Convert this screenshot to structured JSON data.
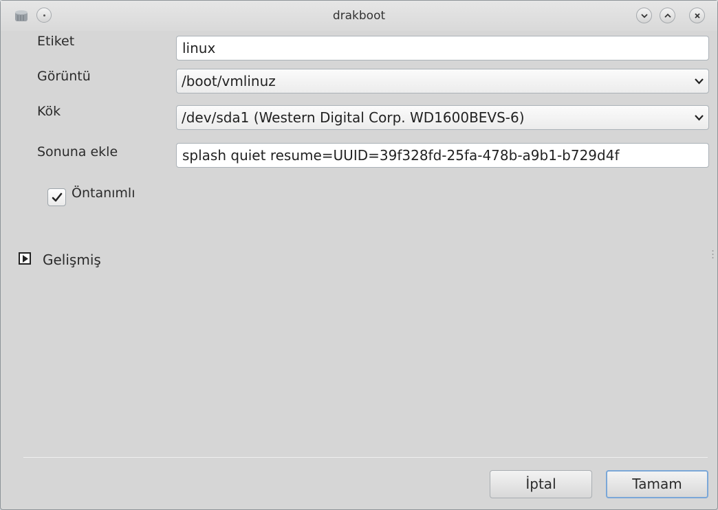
{
  "window": {
    "title": "drakboot"
  },
  "form": {
    "label_field": {
      "label": "Etiket",
      "value": "linux"
    },
    "image_field": {
      "label": "Görüntü",
      "value": "/boot/vmlinuz"
    },
    "root_field": {
      "label": "Kök",
      "value": "/dev/sda1 (Western Digital Corp. WD1600BEVS-6)"
    },
    "append_field": {
      "label": "Sonuna ekle",
      "value": "splash quiet resume=UUID=39f328fd-25fa-478b-a9b1-b729d4f"
    },
    "default_checkbox": {
      "label": "Öntanımlı",
      "checked": true
    },
    "advanced": {
      "label": "Gelişmiş",
      "expanded": false
    }
  },
  "buttons": {
    "cancel": "İptal",
    "ok": "Tamam"
  },
  "icons": {
    "app": "disk-icon",
    "menu": "window-menu-icon",
    "minimize": "minimize-icon",
    "maximize": "maximize-icon",
    "close": "close-icon",
    "combo": "chevron-down-icon",
    "check": "checkmark-icon",
    "expander": "triangle-right-icon"
  }
}
